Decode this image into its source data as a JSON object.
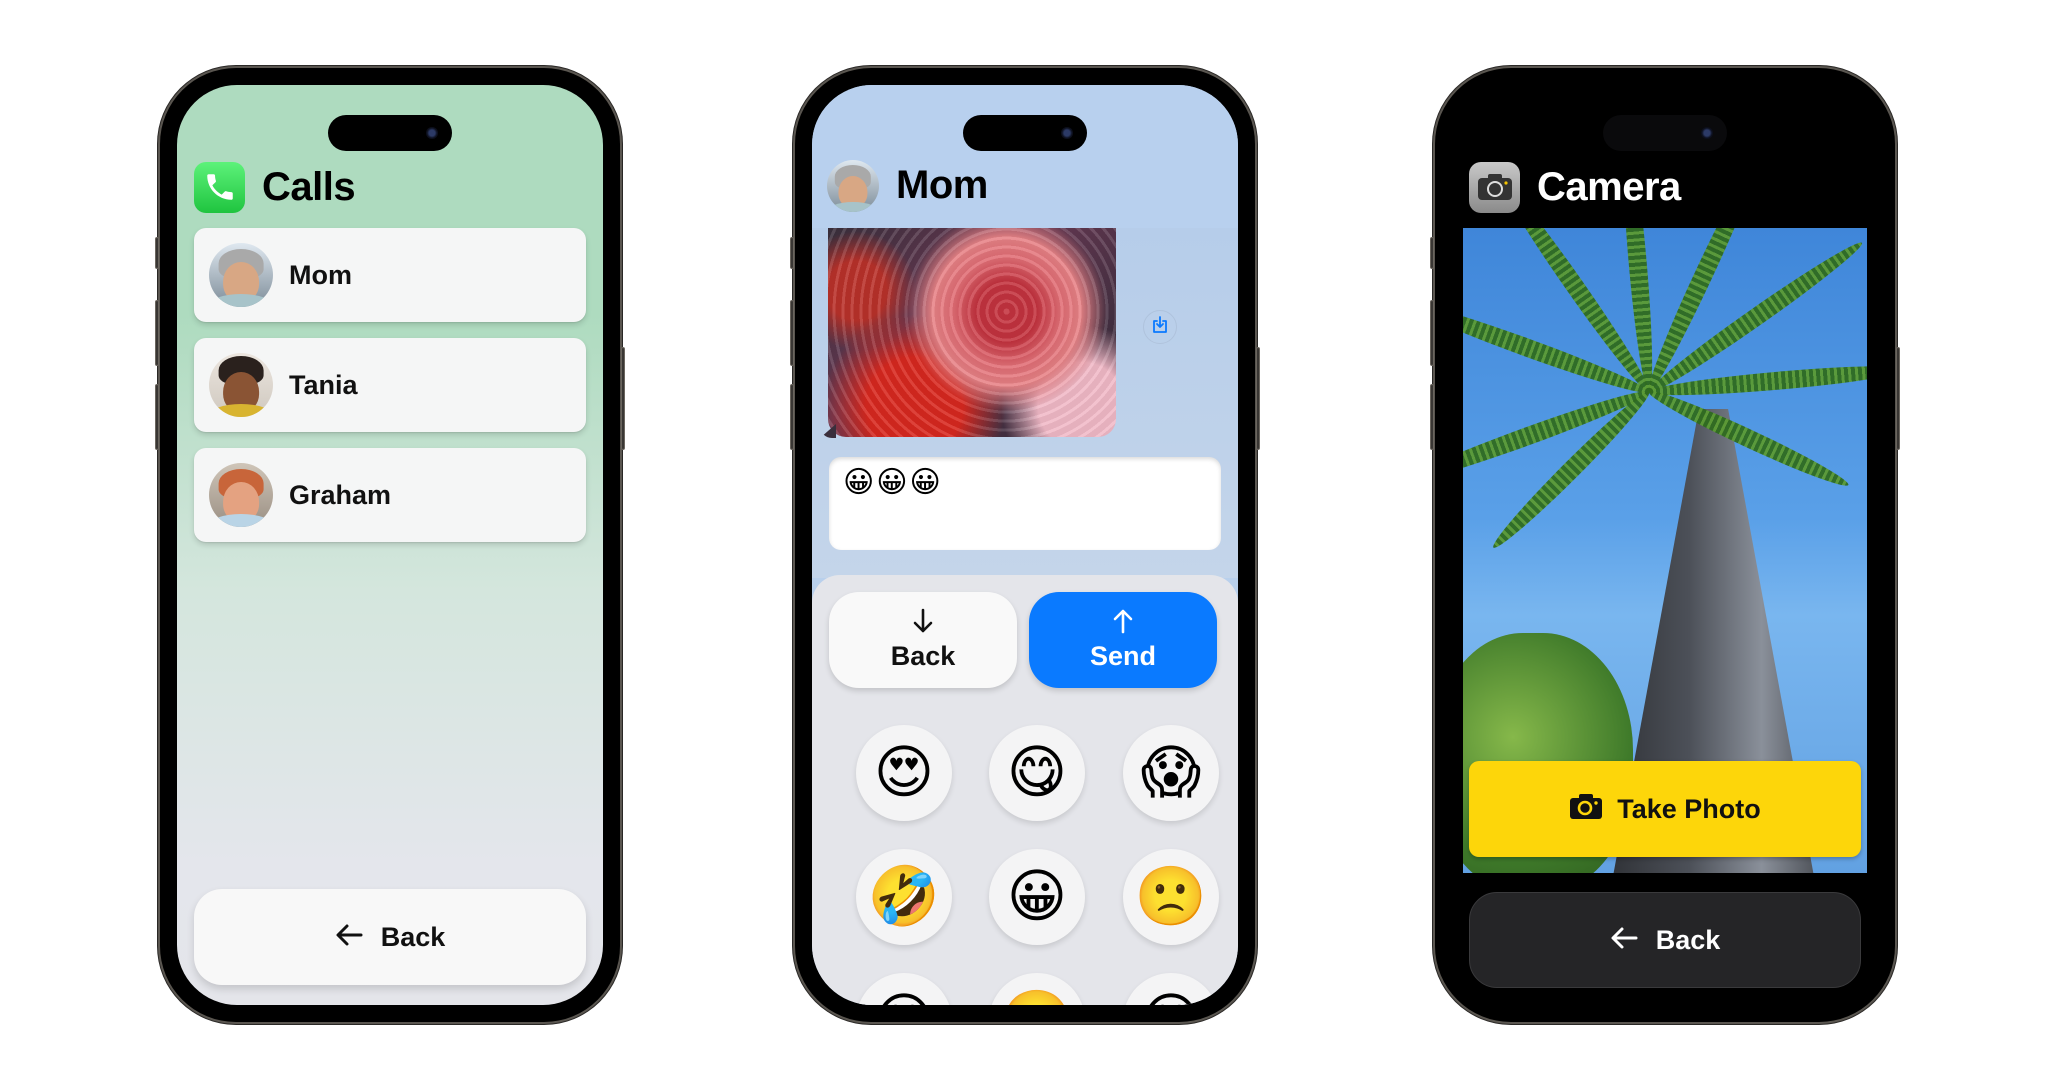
{
  "colors": {
    "calls_bg": "#aedbbf",
    "messages_bg": "#b9d0ec",
    "send_blue": "#0a7aff",
    "take_photo_yellow": "#fdd60a",
    "camera_back_bg": "#252527"
  },
  "calls_screen": {
    "app_icon": "phone-icon",
    "title": "Calls",
    "contacts": [
      {
        "name": "Mom",
        "avatar": "avatar-mom"
      },
      {
        "name": "Tania",
        "avatar": "avatar-tania"
      },
      {
        "name": "Graham",
        "avatar": "avatar-graham"
      }
    ],
    "back_label": "Back",
    "back_icon": "arrow-left-icon"
  },
  "messages_screen": {
    "contact_avatar": "avatar-mom",
    "title": "Mom",
    "received_photo": "flower-bouquet-photo",
    "save_icon": "save-to-photos-icon",
    "compose_text": "😀😀😀",
    "back_label": "Back",
    "back_icon": "arrow-down-icon",
    "send_label": "Send",
    "send_icon": "arrow-up-icon",
    "emoji_keys": [
      "😍",
      "😋",
      "😱",
      "🤣",
      "😀",
      "🙁",
      "😁",
      "🙂",
      "😊"
    ]
  },
  "camera_screen": {
    "app_icon": "camera-icon",
    "title": "Camera",
    "viewfinder": "palm-tree-viewfinder",
    "take_photo_label": "Take Photo",
    "take_photo_icon": "camera-icon",
    "back_label": "Back",
    "back_icon": "arrow-left-icon"
  }
}
